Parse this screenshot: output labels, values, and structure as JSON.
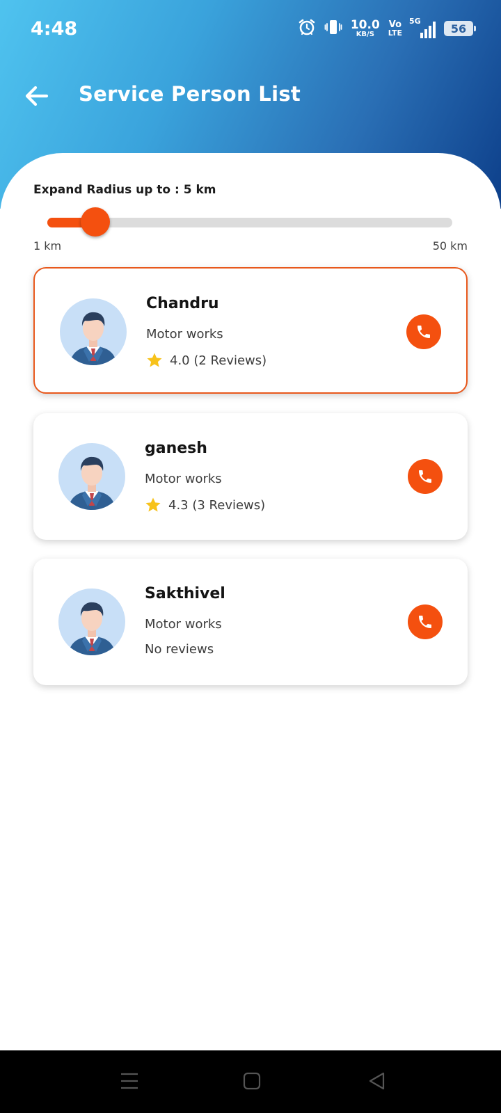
{
  "status_bar": {
    "time": "4:48",
    "net_speed_value": "10.0",
    "net_speed_unit": "KB/S",
    "volte_top": "Vo",
    "volte_bottom": "LTE",
    "network": "5G",
    "battery": "56"
  },
  "appbar": {
    "title": "Service Person List"
  },
  "radius": {
    "label": "Expand Radius up to : 5 km",
    "min_label": "1 km",
    "max_label": "50 km",
    "min": 1,
    "max": 50,
    "value": 5
  },
  "persons": [
    {
      "name": "Chandru",
      "service": "Motor works",
      "rating_text": "4.0 (2 Reviews)",
      "has_rating": true,
      "selected": true
    },
    {
      "name": "ganesh",
      "service": "Motor works",
      "rating_text": "4.3 (3 Reviews)",
      "has_rating": true,
      "selected": false
    },
    {
      "name": "Sakthivel",
      "service": "Motor works",
      "rating_text": "No reviews",
      "has_rating": false,
      "selected": false
    }
  ],
  "colors": {
    "accent": "#f4500f",
    "selected_border": "#e8581c",
    "star": "#f7c21b",
    "header_start": "#4fc3ef",
    "header_end": "#0d3f8a"
  },
  "icons": {
    "back": "arrow-left-icon",
    "call": "phone-icon",
    "rating": "star-icon",
    "avatar": "businessman-avatar-icon"
  }
}
